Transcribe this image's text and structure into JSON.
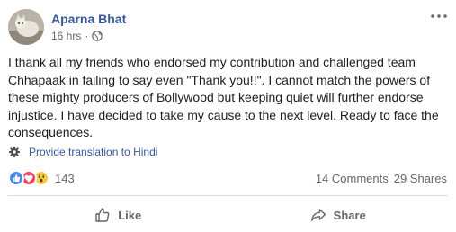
{
  "post": {
    "author": "Aparna Bhat",
    "timestamp": "16 hrs",
    "separator": "·",
    "body_lines": [
      "I thank all my friends who endorsed my contribution and challenged team",
      "Chhapaak in failing to say even \"Thank you!!\". I cannot match the powers of",
      "these mighty producers of Bollywood but keeping quiet will further endorse",
      "injustice. I have decided to take my cause to the next level. Ready to face the",
      "consequences."
    ],
    "translate_label": "Provide translation to Hindi",
    "reactions_count": "143",
    "comments_label": "14 Comments",
    "shares_label": "29 Shares"
  },
  "actions": {
    "like_label": "Like",
    "share_label": "Share"
  },
  "colors": {
    "author": "#385898",
    "meta": "#606770",
    "like_reaction": "#4a89f3",
    "love_reaction": "#f3425f",
    "wow_reaction": "#f7c94c"
  },
  "icons": {
    "more": "more-horizontal-icon",
    "globe": "globe-icon",
    "gear": "gear-icon",
    "like": "thumbs-up-icon",
    "share": "share-arrow-icon"
  }
}
